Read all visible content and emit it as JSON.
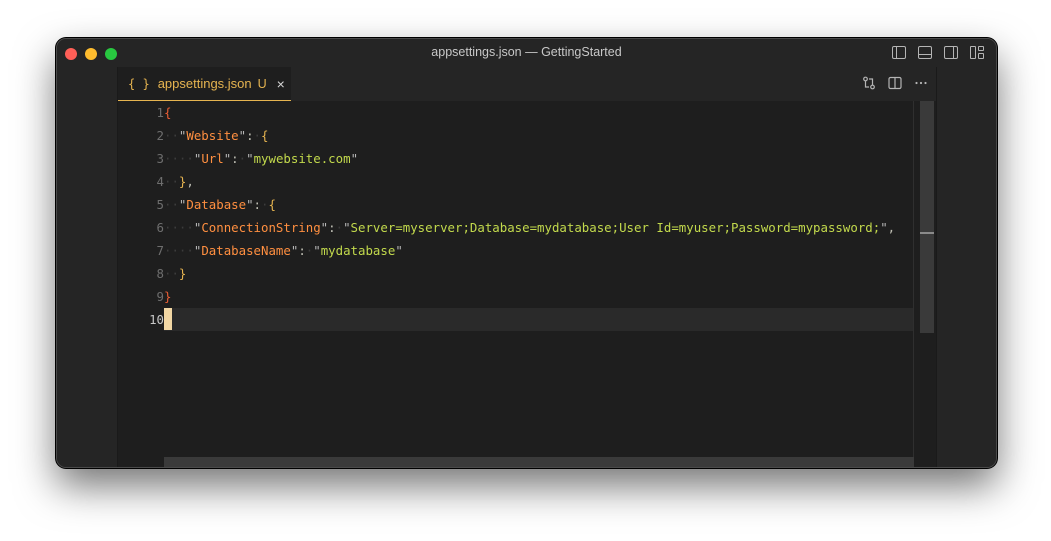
{
  "window": {
    "title": "appsettings.json — GettingStarted"
  },
  "tab": {
    "icon": "{ }",
    "label": "appsettings.json",
    "status": "U",
    "close": "×"
  },
  "editor": {
    "line_numbers": [
      "1",
      "2",
      "3",
      "4",
      "5",
      "6",
      "7",
      "8",
      "9",
      "10"
    ],
    "current_line": 10,
    "language": "json",
    "content": {
      "website_key": "Website",
      "url_key": "Url",
      "url_value": "mywebsite.com",
      "database_key": "Database",
      "connection_key": "ConnectionString",
      "connection_value": "Server=myserver;Database=mydatabase;User Id=myuser;Password=mypassword;",
      "dbname_key": "DatabaseName",
      "dbname_value": "mydatabase"
    }
  },
  "icons": {
    "layout": [
      "toggle-primary-sidebar-icon",
      "toggle-panel-icon",
      "toggle-secondary-sidebar-icon",
      "customize-layout-icon"
    ],
    "editor_actions": [
      "open-changes-icon",
      "split-editor-icon",
      "more-actions-icon"
    ]
  },
  "colors": {
    "accent": "#e6b450",
    "key": "#ff8f40",
    "string": "#c2d94c",
    "bracket_level1": "#ea5e34",
    "bracket_level2": "#e6b450",
    "editor_background": "#1e1e1e"
  }
}
